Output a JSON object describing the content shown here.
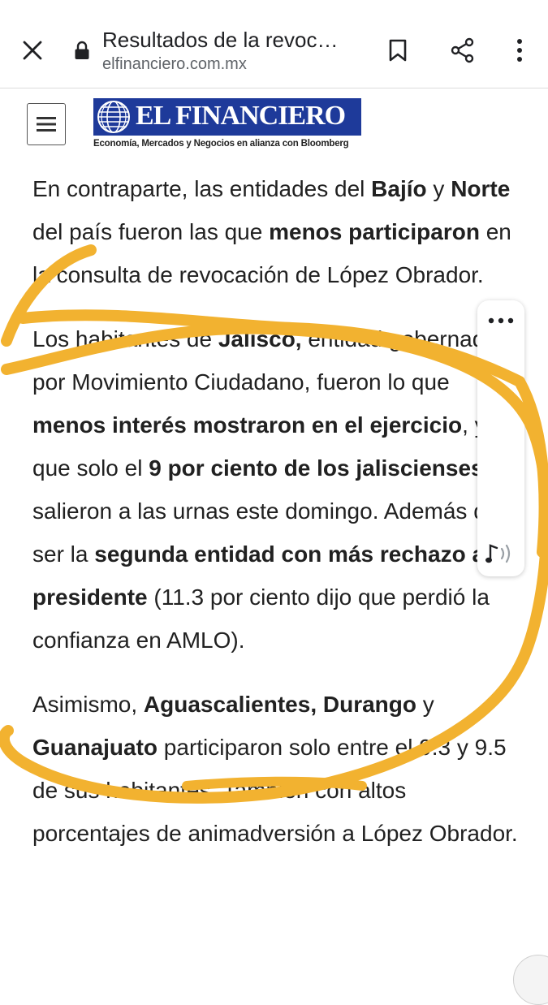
{
  "browser": {
    "title": "Resultados de la revoc…",
    "url": "elfinanciero.com.mx",
    "icons": {
      "close": "close-icon",
      "lock": "lock-icon",
      "bookmark": "bookmark-icon",
      "share": "share-icon",
      "menu": "more-vert-icon"
    }
  },
  "site": {
    "logo_text": "EL FINANCIERO",
    "tagline": "Economía, Mercados y Negocios en alianza con",
    "tagline_brand": "Bloomberg",
    "brand_color": "#1e3a9a"
  },
  "article": {
    "p1": {
      "t1": "En contraparte, las entidades del ",
      "b1": "Bajío",
      "t2": " y ",
      "b2": "Norte",
      "t3": " del país fueron las que ",
      "b3": "menos participaron",
      "t4": " en la consulta de revocación de López Obrador."
    },
    "p2": {
      "t1": "Los habitantes de ",
      "b1": "Jalisco,",
      "t2": " entidad gobernada por Movimiento Ciudadano, fueron lo que ",
      "b2": "menos interés mostraron en el ejercicio",
      "t3": ", ya que solo el ",
      "b3": "9 por ciento de los jaliscienses",
      "t4": " salieron a las urnas este domingo. Además de ser la ",
      "b4": "segunda entidad con más rechazo al presidente",
      "t5": " (11.3 por ciento dijo que perdió la confianza en AMLO)."
    },
    "p3": {
      "t1": "Asimismo, ",
      "b1": "Aguascalientes",
      "t2": ", ",
      "b2": "Durango",
      "t3": " y ",
      "b3": "Guanajuato",
      "t4": " participaron solo entre el 9.3 y 9.5 de sus habitantes. También con altos porcentajes de animadversión a López Obrador."
    }
  },
  "side_panel": {
    "icons": {
      "more": "more-horiz-icon",
      "listen": "listen-audio-icon"
    }
  },
  "annotation": {
    "color": "#f2b230"
  }
}
